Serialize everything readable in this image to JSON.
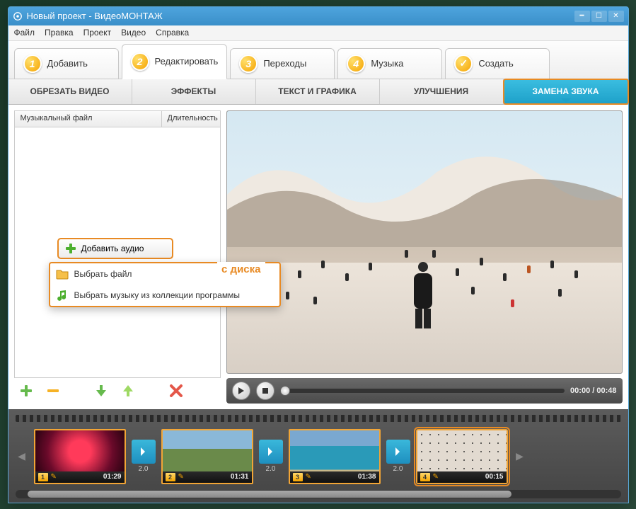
{
  "window": {
    "title": "Новый проект - ВидеоМОНТАЖ"
  },
  "menu": [
    "Файл",
    "Правка",
    "Проект",
    "Видео",
    "Справка"
  ],
  "steps": [
    {
      "num": "1",
      "label": "Добавить"
    },
    {
      "num": "2",
      "label": "Редактировать"
    },
    {
      "num": "3",
      "label": "Переходы"
    },
    {
      "num": "4",
      "label": "Музыка"
    },
    {
      "num": "✓",
      "label": "Создать"
    }
  ],
  "subtabs": [
    "ОБРЕЗАТЬ ВИДЕО",
    "ЭФФЕКТЫ",
    "ТЕКСТ И ГРАФИКА",
    "УЛУЧШЕНИЯ",
    "ЗАМЕНА ЗВУКА"
  ],
  "list": {
    "col1": "Музыкальный файл",
    "col2": "Длительность"
  },
  "addAudio": "Добавить аудио",
  "dropdown": {
    "annotation": "с диска",
    "items": [
      "Выбрать файл",
      "Выбрать музыку из коллекции программы"
    ]
  },
  "player": {
    "current": "00:00",
    "total": "00:48"
  },
  "clips": [
    {
      "idx": "1",
      "time": "01:29"
    },
    {
      "idx": "2",
      "time": "01:31"
    },
    {
      "idx": "3",
      "time": "01:38"
    },
    {
      "idx": "4",
      "time": "00:15"
    }
  ],
  "transition": "2.0"
}
